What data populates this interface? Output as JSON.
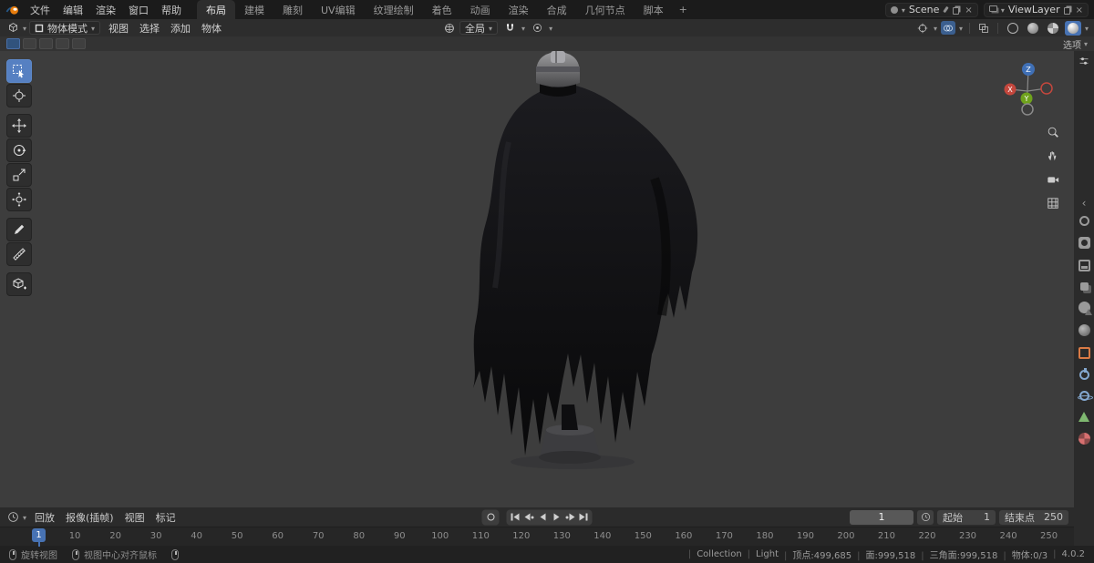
{
  "topbar": {
    "menus": [
      "文件",
      "编辑",
      "渲染",
      "窗口",
      "帮助"
    ],
    "tabs": [
      {
        "label": "布局",
        "active": true
      },
      {
        "label": "建模"
      },
      {
        "label": "雕刻"
      },
      {
        "label": "UV编辑"
      },
      {
        "label": "纹理绘制"
      },
      {
        "label": "着色"
      },
      {
        "label": "动画"
      },
      {
        "label": "渲染"
      },
      {
        "label": "合成"
      },
      {
        "label": "几何节点"
      },
      {
        "label": "脚本"
      }
    ],
    "add_workspace": "+",
    "scene_selector": {
      "value": "Scene"
    },
    "viewlayer_selector": {
      "value": "ViewLayer"
    }
  },
  "viewport_header": {
    "mode_select": {
      "value": "物体模式"
    },
    "menus": [
      "视图",
      "选择",
      "添加",
      "物体"
    ],
    "orientation_select": {
      "value": "全局"
    },
    "shading": {
      "modes": [
        "wireframe",
        "solid",
        "material-preview",
        "rendered"
      ],
      "active": "rendered"
    }
  },
  "tool_settings": {
    "options": "选项"
  },
  "active_tool": "select-box",
  "tools": [
    "select-box",
    "cursor-3d",
    "move",
    "rotate",
    "scale",
    "transform",
    "annotate",
    "measure",
    "add-cube"
  ],
  "gizmo": {
    "x": "X",
    "y": "Y",
    "z": "Z"
  },
  "nav_icons": [
    "zoom",
    "pan",
    "camera-view",
    "orthographic-grid"
  ],
  "properties_tabs": [
    "tool",
    "render",
    "output",
    "view-layer",
    "scene",
    "world",
    "object",
    "modifiers",
    "physics",
    "object-data",
    "material"
  ],
  "timeline": {
    "menus": [
      "回放",
      "报像(插帧)",
      "视图",
      "标记"
    ],
    "transport": [
      "jump-start",
      "prev-keyframe",
      "play-reverse",
      "play",
      "next-keyframe",
      "jump-end"
    ],
    "current_frame": "1",
    "start_label": "起始",
    "start_value": "1",
    "end_label": "结束点",
    "end_value": "250",
    "ruler_frames": [
      1,
      10,
      20,
      30,
      40,
      50,
      60,
      70,
      80,
      90,
      100,
      110,
      120,
      130,
      140,
      150,
      160,
      170,
      180,
      190,
      200,
      210,
      220,
      230,
      240,
      250
    ]
  },
  "statusbar": {
    "hints": [
      {
        "label": "旋转视图"
      },
      {
        "label": "视图中心对齐鼠标"
      },
      {
        "label": ""
      }
    ],
    "stats": [
      "Collection",
      "Light",
      "顶点:499,685",
      "面:999,518",
      "三角面:999,518",
      "物体:0/3",
      "4.0.2"
    ]
  },
  "colors": {
    "accent": "#4772b3",
    "active_tool": "#5680c2",
    "viewport_bg": "#3d3d3d"
  }
}
